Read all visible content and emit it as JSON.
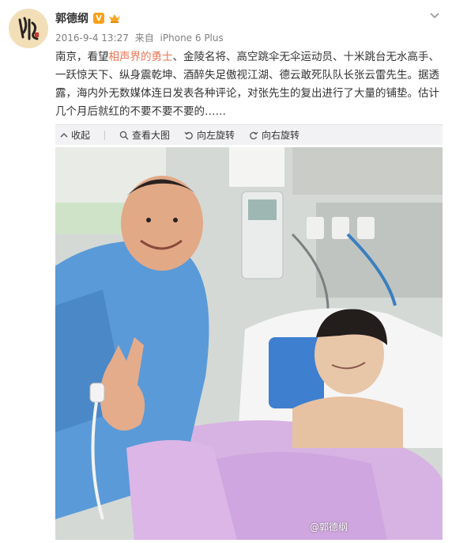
{
  "post": {
    "author": "郭德纲",
    "verified_badge": "V",
    "timestamp": "2016-9-4 13:27",
    "source_prefix": "来自",
    "source": "iPhone 6 Plus",
    "text_before": "南京，看望",
    "text_highlight": "相声界的勇士",
    "text_after": "、金陵名将、高空跳伞无伞运动员、十米跳台无水高手、一跃惊天下、纵身震乾坤、酒醉失足傲视江湖、德云敢死队队长张云雷先生。据透露，海内外无数媒体连日发表各种评论，对张先生的复出进行了大量的铺垫。估计几个月后就红的不要不要不要的……"
  },
  "toolbar": {
    "collapse": "收起",
    "view_large": "查看大图",
    "rotate_left": "向左旋转",
    "rotate_right": "向右旋转"
  },
  "photo": {
    "watermark": "@郭德纲"
  },
  "colors": {
    "highlight": "#eb7350",
    "verified": "#f8a01a",
    "meta_text": "#808080",
    "toolbar_bg": "#f2f2f5"
  },
  "icons": {
    "avatar": "calligraphy-logo",
    "crown": "crown-icon",
    "more": "chevron-down-icon",
    "collapse": "collapse-arrow-icon",
    "view_large": "magnify-icon",
    "rotate_left": "rotate-left-icon",
    "rotate_right": "rotate-right-icon"
  }
}
